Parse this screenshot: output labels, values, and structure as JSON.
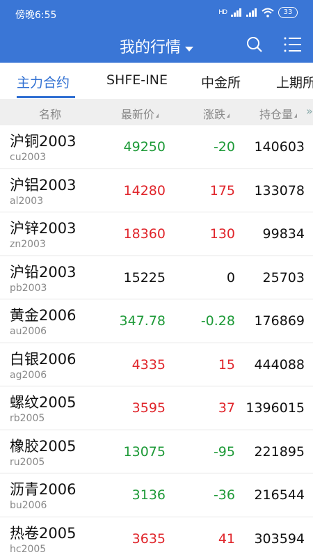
{
  "status_bar": {
    "time": "傍晚6:55",
    "network": "HD",
    "battery": "33"
  },
  "header": {
    "title": "我的行情"
  },
  "tabs": [
    {
      "label": "主力合约",
      "active": true
    },
    {
      "label": "SHFE-INE",
      "active": false
    },
    {
      "label": "中金所",
      "active": false
    },
    {
      "label": "上期所",
      "active": false
    }
  ],
  "columns": {
    "name": "名称",
    "price": "最新价",
    "change": "涨跌",
    "open_interest": "持仓量",
    "more": "»"
  },
  "colors": {
    "primary": "#3a76d6",
    "up": "#e0262c",
    "down": "#1e9a38"
  },
  "rows": [
    {
      "name": "沪铜2003",
      "code": "cu2003",
      "price": "49250",
      "change": "-20",
      "open_interest": "140603",
      "trend": "down"
    },
    {
      "name": "沪铝2003",
      "code": "al2003",
      "price": "14280",
      "change": "175",
      "open_interest": "133078",
      "trend": "up"
    },
    {
      "name": "沪锌2003",
      "code": "zn2003",
      "price": "18360",
      "change": "130",
      "open_interest": "99834",
      "trend": "up"
    },
    {
      "name": "沪铅2003",
      "code": "pb2003",
      "price": "15225",
      "change": "0",
      "open_interest": "25703",
      "trend": "flat"
    },
    {
      "name": "黄金2006",
      "code": "au2006",
      "price": "347.78",
      "change": "-0.28",
      "open_interest": "176869",
      "trend": "down"
    },
    {
      "name": "白银2006",
      "code": "ag2006",
      "price": "4335",
      "change": "15",
      "open_interest": "444088",
      "trend": "up"
    },
    {
      "name": "螺纹2005",
      "code": "rb2005",
      "price": "3595",
      "change": "37",
      "open_interest": "1396015",
      "trend": "up"
    },
    {
      "name": "橡胶2005",
      "code": "ru2005",
      "price": "13075",
      "change": "-95",
      "open_interest": "221895",
      "trend": "down"
    },
    {
      "name": "沥青2006",
      "code": "bu2006",
      "price": "3136",
      "change": "-36",
      "open_interest": "216544",
      "trend": "down"
    },
    {
      "name": "热卷2005",
      "code": "hc2005",
      "price": "3635",
      "change": "41",
      "open_interest": "303594",
      "trend": "up"
    }
  ]
}
